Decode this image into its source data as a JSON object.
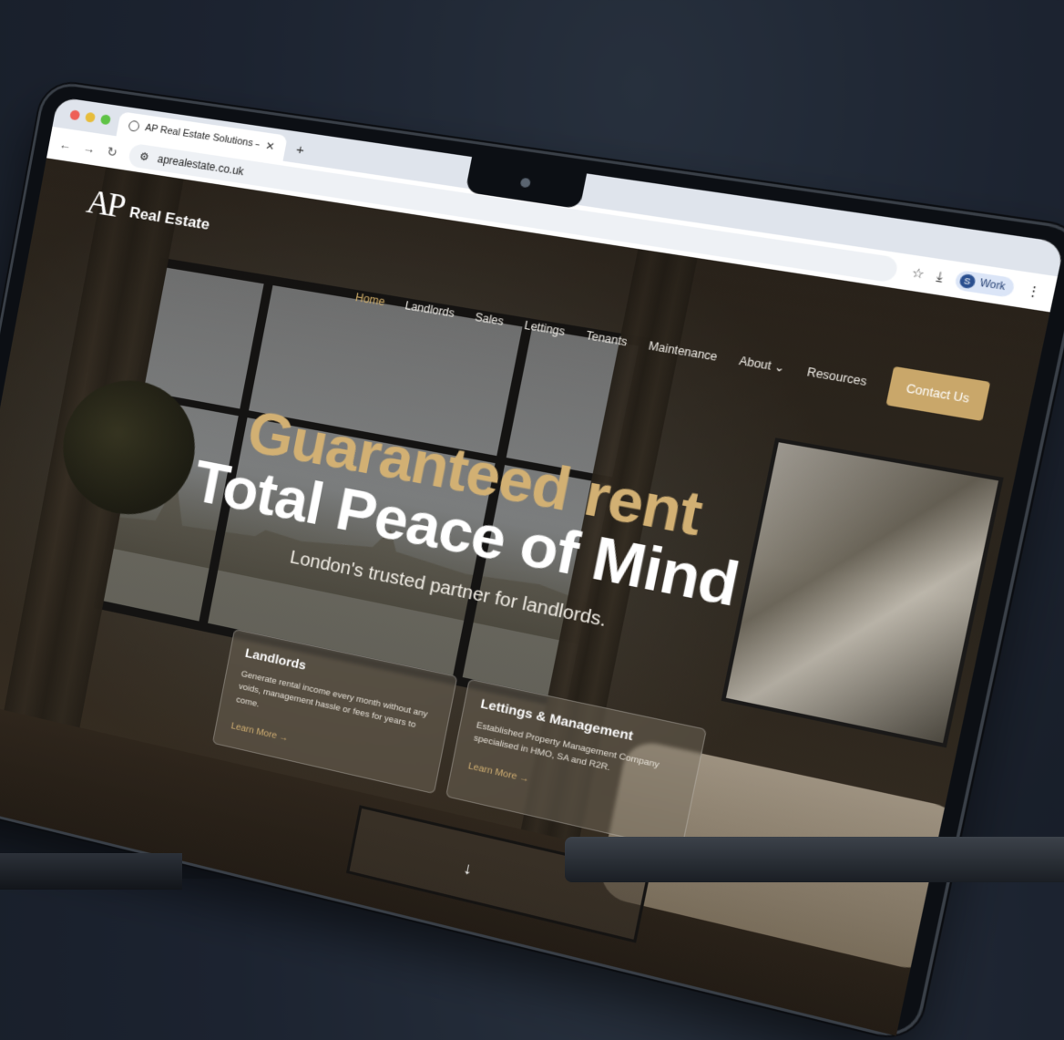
{
  "browser": {
    "tab_title": "AP Real Estate Solutions – Gu",
    "url": "aprealestate.co.uk",
    "profile_initial": "S",
    "profile_label": "Work"
  },
  "site": {
    "logo_mark": "AP",
    "brand": "Real Estate",
    "nav": [
      "Home",
      "Landlords",
      "Sales",
      "Lettings",
      "Tenants",
      "Maintenance",
      "About",
      "Resources"
    ],
    "contact_label": "Contact Us"
  },
  "hero": {
    "headline_gold": "Guaranteed rent",
    "headline_white": "Total Peace of Mind",
    "subheadline": "London's trusted partner for landlords."
  },
  "cards": [
    {
      "title": "Landlords",
      "text": "Generate rental income every month without any voids, management hassle or fees for years to come.",
      "link": "Learn More →"
    },
    {
      "title": "Lettings & Management",
      "text": "Established Property Management Company specialised in HMO, SA and R2R.",
      "link": "Learn More →"
    }
  ],
  "colors": {
    "accent_gold": "#c9a76a",
    "background": "#1c2330"
  }
}
